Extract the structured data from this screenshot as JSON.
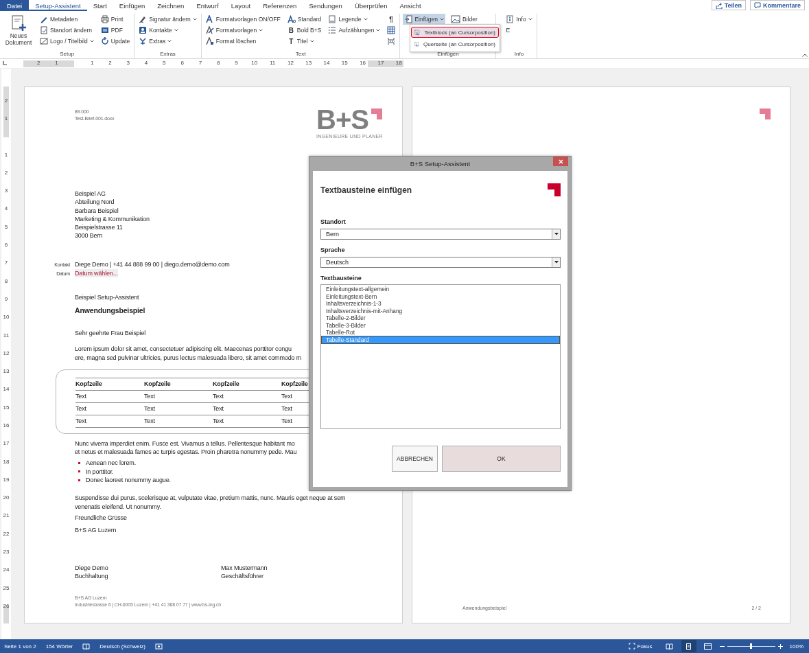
{
  "ribbon_tabs": [
    {
      "label": "Datei",
      "kind": "file",
      "selected": false
    },
    {
      "label": "Setup-Assistent",
      "kind": "tab",
      "selected": true
    },
    {
      "label": "Start",
      "kind": "tab",
      "selected": false
    },
    {
      "label": "Einfügen",
      "kind": "tab",
      "selected": false
    },
    {
      "label": "Zeichnen",
      "kind": "tab",
      "selected": false
    },
    {
      "label": "Entwurf",
      "kind": "tab",
      "selected": false
    },
    {
      "label": "Layout",
      "kind": "tab",
      "selected": false
    },
    {
      "label": "Referenzen",
      "kind": "tab",
      "selected": false
    },
    {
      "label": "Sendungen",
      "kind": "tab",
      "selected": false
    },
    {
      "label": "Überprüfen",
      "kind": "tab",
      "selected": false
    },
    {
      "label": "Ansicht",
      "kind": "tab",
      "selected": false
    }
  ],
  "share_buttons": [
    {
      "label": "Teilen"
    },
    {
      "label": "Kommentare"
    }
  ],
  "ribbon_groups": [
    {
      "label": "Setup",
      "columns": [
        [
          {
            "label": "Neues Dokument",
            "kind": "large",
            "dropdown": false,
            "pressed": false
          }
        ],
        [
          {
            "label": "Metadaten",
            "kind": "small",
            "dropdown": false,
            "pressed": false
          },
          {
            "label": "Standort ändern",
            "kind": "small",
            "dropdown": false,
            "pressed": false
          },
          {
            "label": "Logo / Titelbild",
            "kind": "small",
            "dropdown": true,
            "pressed": false
          }
        ],
        [
          {
            "label": "Print",
            "kind": "small",
            "dropdown": false,
            "pressed": false
          },
          {
            "label": "PDF",
            "kind": "small",
            "dropdown": false,
            "pressed": false
          },
          {
            "label": "Update",
            "kind": "small",
            "dropdown": false,
            "pressed": false
          }
        ]
      ]
    },
    {
      "label": "Extras",
      "columns": [
        [
          {
            "label": "Signatur ändern",
            "kind": "small",
            "dropdown": true,
            "pressed": false
          },
          {
            "label": "Kontakte",
            "kind": "small",
            "dropdown": true,
            "pressed": false
          },
          {
            "label": "Extras",
            "kind": "small",
            "dropdown": true,
            "pressed": false
          }
        ]
      ]
    },
    {
      "label": "Text",
      "columns": [
        [
          {
            "label": "Formatvorlagen ON/OFF",
            "kind": "small",
            "dropdown": false,
            "pressed": false
          },
          {
            "label": "Formatvorlagen",
            "kind": "small",
            "dropdown": true,
            "pressed": false
          },
          {
            "label": "Format löschen",
            "kind": "small",
            "dropdown": false,
            "pressed": false
          }
        ],
        [
          {
            "label": "Standard",
            "kind": "small",
            "dropdown": false,
            "pressed": false
          },
          {
            "label": "Bold B+S",
            "kind": "glyph",
            "glyph": "B",
            "dropdown": false,
            "pressed": false
          },
          {
            "label": "Titel",
            "kind": "glyph",
            "glyph": "T",
            "dropdown": true,
            "pressed": false
          }
        ],
        [
          {
            "label": "Legende",
            "kind": "small",
            "dropdown": true,
            "pressed": false
          },
          {
            "label": "Aufzählungen",
            "kind": "small",
            "dropdown": true,
            "pressed": false
          }
        ],
        [
          {
            "kind": "glyph-only",
            "glyph": "¶",
            "dropdown": false,
            "pressed": false
          },
          {
            "kind": "icon",
            "dropdown": false,
            "pressed": false
          },
          {
            "kind": "icon",
            "dropdown": false,
            "pressed": false
          }
        ]
      ]
    },
    {
      "label": "Einfügen",
      "columns": [
        [
          {
            "label": "Einfügen",
            "kind": "small",
            "dropdown": true,
            "pressed": true
          }
        ],
        [
          {
            "label": "Bilder",
            "kind": "small",
            "dropdown": false,
            "pressed": false
          }
        ]
      ]
    },
    {
      "label": "Info",
      "columns": [
        [
          {
            "label": "Info",
            "kind": "small",
            "dropdown": true,
            "pressed": false
          },
          {
            "label": "E",
            "kind": "text"
          }
        ]
      ]
    }
  ],
  "dropdown_menu": [
    {
      "label": "Textblock (an Cursorposition)",
      "selected": true
    },
    {
      "label": "Querseite (an Cursorposition)",
      "selected": false
    }
  ],
  "ruler": {
    "labels_before_origin": [
      "2",
      "1"
    ],
    "labels_after_origin": [
      "1",
      "2",
      "3",
      "4",
      "5",
      "6",
      "7",
      "8",
      "9",
      "10",
      "11",
      "12",
      "13",
      "14",
      "15",
      "16",
      "17",
      "18"
    ]
  },
  "vertical_ruler": {
    "labels_before_origin": [
      "2",
      "1"
    ],
    "labels_after_origin": [
      "1",
      "2",
      "3",
      "4",
      "5",
      "6",
      "7",
      "8",
      "9",
      "10",
      "11",
      "12",
      "13",
      "14",
      "15",
      "16",
      "17",
      "18",
      "19",
      "20",
      "21",
      "22",
      "23",
      "24",
      "25",
      "26"
    ]
  },
  "page_1": {
    "header_lines": [
      "89.000",
      "Test-Brief-001.docx"
    ],
    "logo": {
      "mark": "B+S",
      "tagline": "INGENIEURE UND PLANER"
    },
    "address": [
      "Beispiel AG",
      "Abteilung Nord",
      "Barbara Beispiel",
      "Marketing & Kommunikation",
      "Beispielstrasse 11",
      "3000 Bern"
    ],
    "contact": {
      "label": "Kontakt",
      "value": "Diege Demo | +41 44 888 99 00 | diego.demo@demo.com"
    },
    "date": {
      "label": "Datum",
      "value": "Datum wählen..."
    },
    "reference": "Beispiel Setup-Assistent",
    "subject": "Anwendungsbeispiel",
    "salutation": "Sehr geehrte Frau Beispiel",
    "paragraph_1": [
      "Lorem ipsum dolor sit amet, consectetuer adipiscing elit. Maecenas porttitor congu",
      "ere, magna sed pulvinar ultricies, purus lectus malesuada libero, sit amet commodo m"
    ],
    "table": {
      "columns": [
        "Kopfzeile",
        "Kopfzeile",
        "Kopfzeile",
        "Kopfzeile"
      ],
      "rows": [
        [
          "Text",
          "Text",
          "Text",
          "Text"
        ],
        [
          "Text",
          "Text",
          "Text",
          "Text"
        ],
        [
          "Text",
          "Text",
          "Text",
          "Text"
        ]
      ]
    },
    "paragraph_2": [
      "Nunc viverra imperdiet enim. Fusce est. Vivamus a tellus. Pellentesque habitant mo",
      "et netus et malesuada fames ac turpis egestas. Proin pharetra nonummy pede. Mau"
    ],
    "bullets": [
      "Aenean nec lorem.",
      "In porttitor.",
      "Donec laoreet nonummy augue."
    ],
    "paragraph_3": [
      "Suspendisse dui purus, scelerisque at, vulputate vitae, pretium mattis, nunc. Mauris eget neque at sem",
      "venenatis eleifend. Ut nonummy."
    ],
    "closing": "Freundliche Grüsse",
    "company": "B+S AG Luzern",
    "signatures": [
      {
        "name": "Diege Demo",
        "role": "Buchhaltung"
      },
      {
        "name": "Max Mustermann",
        "role": "Geschäftsführer"
      }
    ],
    "footer": [
      "B+S AG Luzern",
      "Industriestrasse 6 | CH-6005 Luzern | +41 41 368 07 77 | www.bs-ing.ch"
    ]
  },
  "page_2": {
    "footer_text": "Anwendungsbeispiel",
    "page_number": "2 / 2"
  },
  "dialog": {
    "title": "B+S Setup-Assistent",
    "heading": "Textbausteine einfügen",
    "fields": [
      {
        "label": "Standort",
        "value": "Bern"
      },
      {
        "label": "Sprache",
        "value": "Deutsch"
      }
    ],
    "list": {
      "label": "Textbausteine",
      "items": [
        {
          "label": "Einleitungstext-allgemein",
          "selected": false
        },
        {
          "label": "Einleitungstext-Bern",
          "selected": false
        },
        {
          "label": "Inhaltsverzeichnis-1-3",
          "selected": false
        },
        {
          "label": "Inhaltsverzeichnis-mit-Anhang",
          "selected": false
        },
        {
          "label": "Tabelle-2-Bilder",
          "selected": false
        },
        {
          "label": "Tabelle-3-Bilder",
          "selected": false
        },
        {
          "label": "Tabelle-Rot",
          "selected": false
        },
        {
          "label": "Tabelle-Standard",
          "selected": true
        }
      ]
    },
    "buttons": [
      {
        "label": "ABBRECHEN",
        "kind": "secondary"
      },
      {
        "label": "OK",
        "kind": "primary"
      }
    ]
  },
  "status_bar": {
    "page": "Seite 1 von 2",
    "words": "154 Wörter",
    "language": "Deutsch (Schweiz)",
    "focus": "Fokus",
    "views": [
      {
        "selected": false
      },
      {
        "selected": true
      },
      {
        "selected": false
      }
    ],
    "zoom": {
      "level": 0.5,
      "reading": "100%"
    }
  }
}
